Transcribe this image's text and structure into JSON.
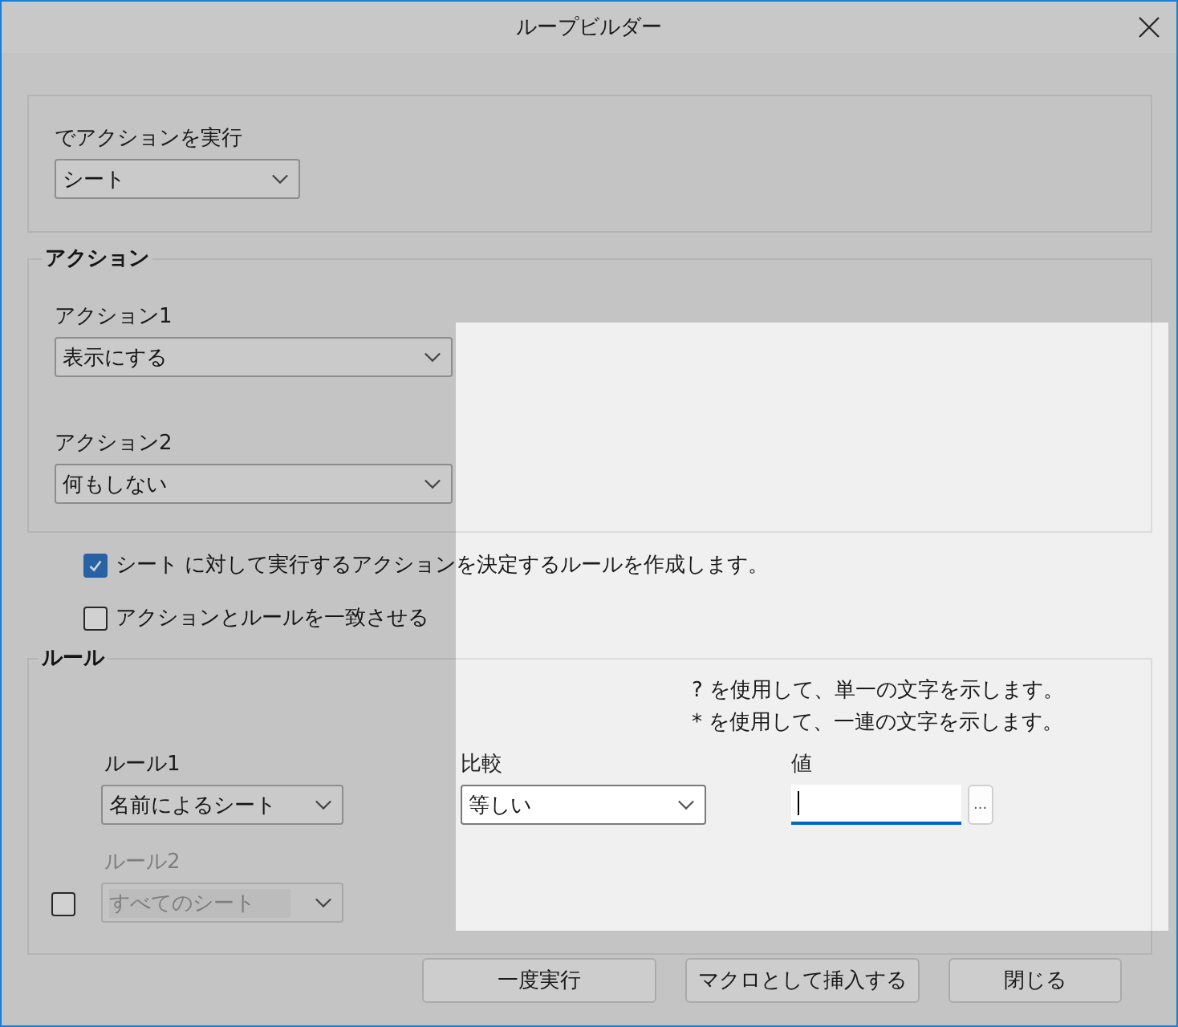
{
  "window": {
    "title": "ループビルダー"
  },
  "run_on": {
    "label": "でアクションを実行",
    "value": "シート"
  },
  "actions": {
    "title": "アクション",
    "items": [
      {
        "label": "アクション1",
        "value": "表示にする"
      },
      {
        "label": "アクション2",
        "value": "何もしない"
      }
    ]
  },
  "options": [
    {
      "label": "シート に対して実行するアクションを決定するルールを作成します。",
      "checked": true
    },
    {
      "label": "アクションとルールを一致させる",
      "checked": false
    }
  ],
  "rules": {
    "title": "ルール",
    "hints": [
      "? を使用して、単一の文字を示します。",
      "* を使用して、一連の文字を示します。"
    ],
    "compare_label": "比較",
    "value_label": "値",
    "items": [
      {
        "label": "ルール1",
        "value": "名前によるシート",
        "disabled": false
      },
      {
        "label": "ルール2",
        "value": "すべてのシート",
        "disabled": true,
        "checked": false
      }
    ],
    "compare": "等しい",
    "value_field": {
      "focused": true
    },
    "browse_button": "..."
  },
  "buttons": [
    "一度実行",
    "マクロとして挿入する",
    "閉じる"
  ],
  "spotlight": {
    "on": true
  }
}
